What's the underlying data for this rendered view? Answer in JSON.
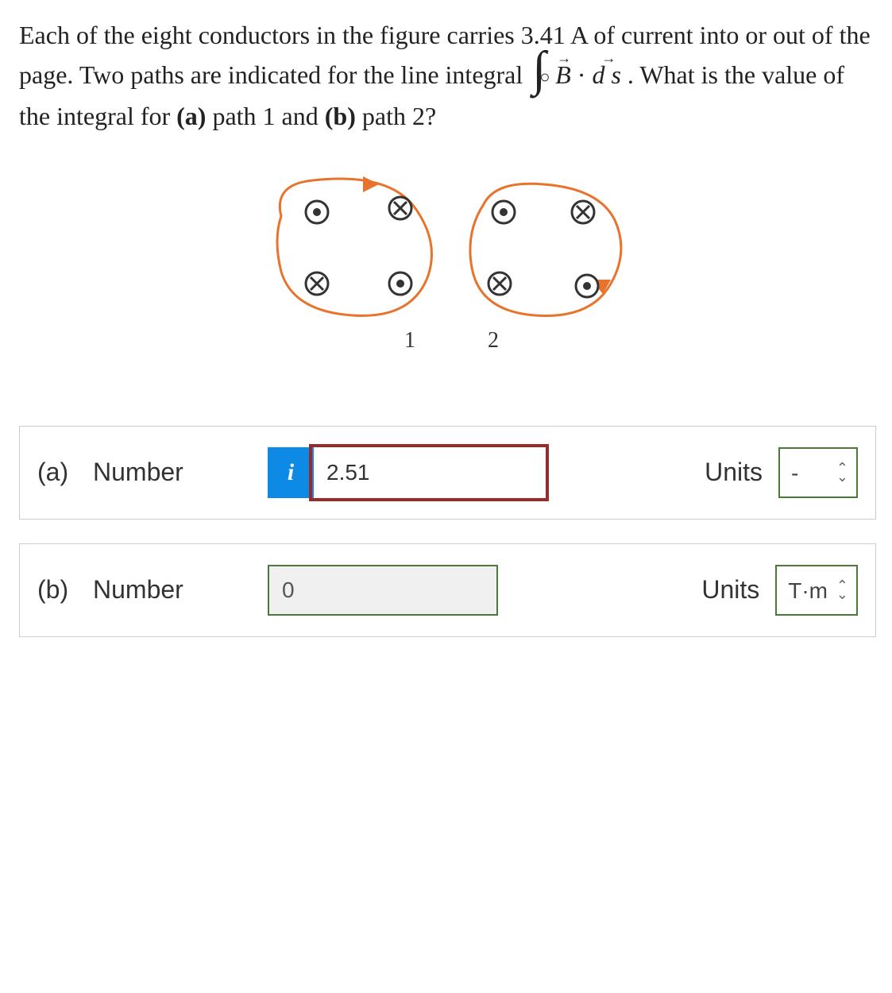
{
  "question": {
    "part1": "Each of the eight conductors in the figure carries 3.41 A of current into or out of the page. Two paths are indicated for the line integral ",
    "part2": ". What is the value of the integral for ",
    "a_bold": "(a)",
    "a_text": " path 1 and ",
    "b_bold": "(b)",
    "b_text": " path 2?"
  },
  "figure": {
    "label1": "1",
    "label2": "2"
  },
  "answers": {
    "a": {
      "part": "(a)",
      "label": "Number",
      "badge": "i",
      "value": "2.51",
      "units_label": "Units",
      "units_value": "-"
    },
    "b": {
      "part": "(b)",
      "label": "Number",
      "value": "0",
      "units_label": "Units",
      "units_value": "T·m"
    }
  }
}
